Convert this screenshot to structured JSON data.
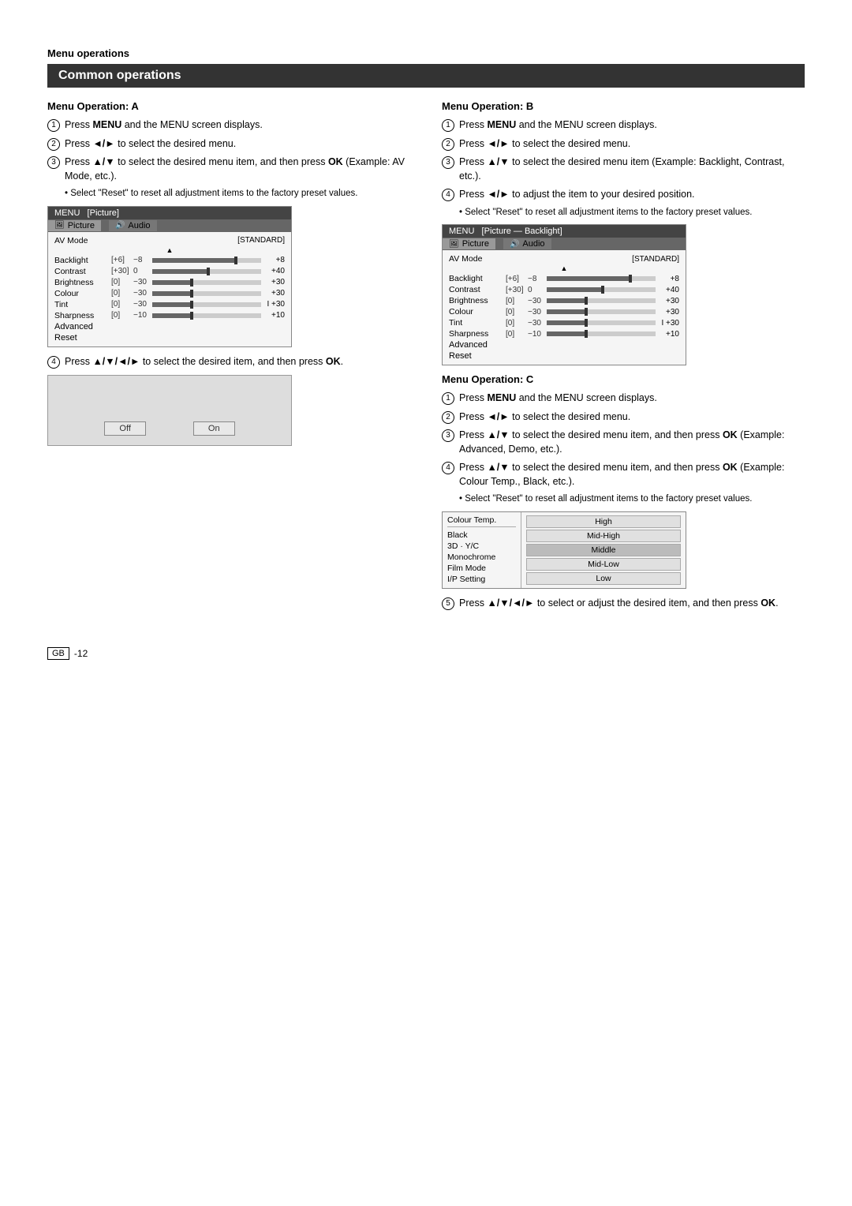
{
  "page": {
    "section_header": "Menu operations",
    "common_title": "Common operations",
    "footer_badge": "GB",
    "footer_page": "-12"
  },
  "menu_op_a": {
    "title": "Menu Operation: A",
    "steps": [
      {
        "num": "1",
        "text": "Press ",
        "bold": "MENU",
        "text2": " and the MENU screen displays."
      },
      {
        "num": "2",
        "text": "Press ",
        "bold": "◄/►",
        "text2": " to select the desired menu."
      },
      {
        "num": "3",
        "text": "Press ",
        "bold": "▲/▼",
        "text2": " to select the desired menu item, and then press ",
        "bold2": "OK",
        "text3": " (Example: AV Mode, etc.)."
      }
    ],
    "bullet": "Select \"Reset\" to reset all adjustment items to the factory preset values.",
    "step4_text": "Press ",
    "step4_bold": "▲/▼/◄/►",
    "step4_text2": " to select the desired item, and then press ",
    "step4_bold2": "OK",
    "step4_text3": "."
  },
  "menu_op_b": {
    "title": "Menu Operation: B",
    "steps": [
      {
        "num": "1",
        "text": "Press ",
        "bold": "MENU",
        "text2": " and the MENU screen displays."
      },
      {
        "num": "2",
        "text": "Press ",
        "bold": "◄/►",
        "text2": " to select the desired menu."
      },
      {
        "num": "3",
        "text": "Press ",
        "bold": "▲/▼",
        "text2": " to select the desired menu item (Example: Backlight, Contrast, etc.)."
      }
    ],
    "step4_text": "Press ",
    "step4_bold": "◄/►",
    "step4_text2": " to adjust the item to your desired position.",
    "bullet": "Select \"Reset\" to reset all adjustment items to the factory preset values."
  },
  "menu_op_c": {
    "title": "Menu Operation: C",
    "steps": [
      {
        "num": "1",
        "text": "Press ",
        "bold": "MENU",
        "text2": " and the MENU screen displays."
      },
      {
        "num": "2",
        "text": "Press ",
        "bold": "◄/►",
        "text2": " to select the desired menu."
      },
      {
        "num": "3",
        "text": "Press ",
        "bold": "▲/▼",
        "text2": " to select the desired menu item, and then press ",
        "bold2": "OK",
        "text3": " (Example: Advanced, Demo, etc.)."
      },
      {
        "num": "4",
        "text": "Press ",
        "bold": "▲/▼",
        "text2": " to select the desired menu item, and then press ",
        "bold2": "OK",
        "text3": " (Example: Colour Temp., Black, etc.)."
      }
    ],
    "bullet": "Select \"Reset\" to reset all adjustment items to the factory preset values.",
    "step5_text": "Press ",
    "step5_bold": "▲/▼/◄/►",
    "step5_text2": " to select or adjust the desired item, and then press ",
    "step5_bold2": "OK",
    "step5_text3": "."
  },
  "menu_a_screenshot": {
    "title": "MENU",
    "subtitle": "[Picture]",
    "tab1": "Picture",
    "tab2": "Audio",
    "rows": [
      {
        "label": "AV Mode",
        "bracket": "",
        "val": "",
        "end": "[STANDARD]",
        "has_slider": false
      },
      {
        "label": "Backlight",
        "bracket": "[+6]",
        "val": "−8",
        "end": "+8",
        "has_slider": true,
        "fill": 75
      },
      {
        "label": "Contrast",
        "bracket": "[+30]",
        "val": "0",
        "end": "+40",
        "has_slider": true,
        "fill": 55
      },
      {
        "label": "Brightness",
        "bracket": "[0]",
        "val": "−30",
        "end": "+30",
        "has_slider": true,
        "fill": 40
      },
      {
        "label": "Colour",
        "bracket": "[0]",
        "val": "−30",
        "end": "+30",
        "has_slider": true,
        "fill": 40
      },
      {
        "label": "Tint",
        "bracket": "[0]",
        "val": "−30",
        "end": "I +30",
        "has_slider": true,
        "fill": 40
      },
      {
        "label": "Sharpness",
        "bracket": "[0]",
        "val": "−10",
        "end": "+10",
        "has_slider": true,
        "fill": 40
      },
      {
        "label": "Advanced",
        "bracket": "",
        "val": "",
        "end": "",
        "has_slider": false
      },
      {
        "label": "Reset",
        "bracket": "",
        "val": "",
        "end": "",
        "has_slider": false
      }
    ]
  },
  "menu_b_screenshot": {
    "title": "MENU",
    "subtitle": "[Picture — Backlight]",
    "tab1": "Picture",
    "tab2": "Audio",
    "rows": [
      {
        "label": "AV Mode",
        "bracket": "",
        "val": "",
        "end": "[STANDARD]",
        "has_slider": false
      },
      {
        "label": "Backlight",
        "bracket": "[+6]",
        "val": "−8",
        "end": "+8",
        "has_slider": true,
        "fill": 75
      },
      {
        "label": "Contrast",
        "bracket": "[+30]",
        "val": "0",
        "end": "+40",
        "has_slider": true,
        "fill": 55
      },
      {
        "label": "Brightness",
        "bracket": "[0]",
        "val": "−30",
        "end": "+30",
        "has_slider": true,
        "fill": 40
      },
      {
        "label": "Colour",
        "bracket": "[0]",
        "val": "−30",
        "end": "+30",
        "has_slider": true,
        "fill": 40
      },
      {
        "label": "Tint",
        "bracket": "[0]",
        "val": "−30",
        "end": "I +30",
        "has_slider": true,
        "fill": 40
      },
      {
        "label": "Sharpness",
        "bracket": "[0]",
        "val": "−10",
        "end": "+10",
        "has_slider": true,
        "fill": 40
      },
      {
        "label": "Advanced",
        "bracket": "",
        "val": "",
        "end": "",
        "has_slider": false
      },
      {
        "label": "Reset",
        "bracket": "",
        "val": "",
        "end": "",
        "has_slider": false
      }
    ]
  },
  "colour_menu": {
    "left_title": "Colour Temp.",
    "items": [
      "Black",
      "3D · Y/C",
      "Monochrome",
      "Film Mode",
      "I/P Setting"
    ],
    "options": [
      "High",
      "Mid-High",
      "Middle",
      "Mid-Low",
      "Low"
    ]
  },
  "offon": {
    "off_label": "Off",
    "on_label": "On"
  }
}
